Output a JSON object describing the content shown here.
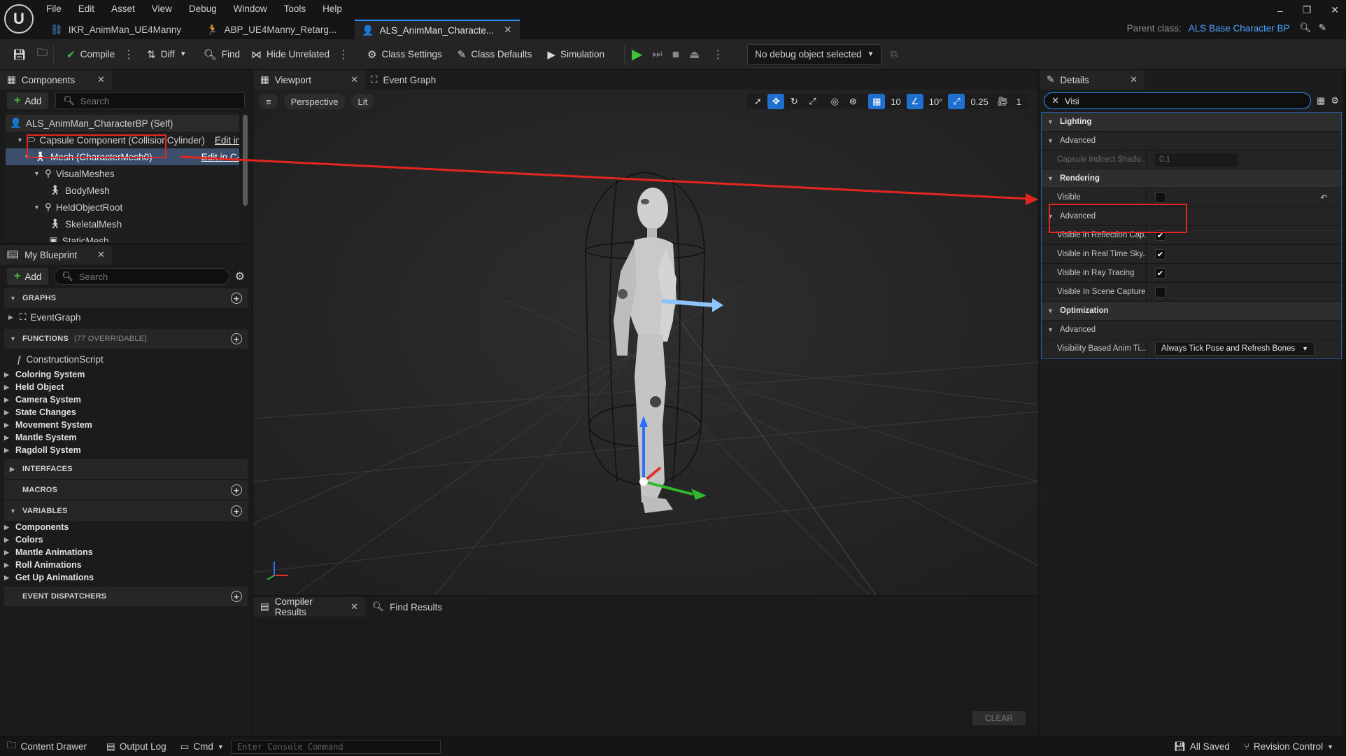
{
  "menu": [
    "File",
    "Edit",
    "Asset",
    "View",
    "Debug",
    "Window",
    "Tools",
    "Help"
  ],
  "tabs": [
    {
      "label": "IKR_AnimMan_UE4Manny",
      "icon": "ik-rig-icon"
    },
    {
      "label": "ABP_UE4Manny_Retarg...",
      "icon": "anim-blueprint-icon"
    },
    {
      "label": "ALS_AnimMan_Characte...",
      "icon": "blueprint-character-icon"
    }
  ],
  "parent_class": {
    "label": "Parent class:",
    "value": "ALS Base Character BP"
  },
  "toolbar": {
    "compile": "Compile",
    "diff": "Diff",
    "find": "Find",
    "hide_unrelated": "Hide Unrelated",
    "class_settings": "Class Settings",
    "class_defaults": "Class Defaults",
    "simulation": "Simulation",
    "debug_object": "No debug object selected"
  },
  "components": {
    "tab": "Components",
    "add": "Add",
    "search_placeholder": "Search",
    "tree": [
      {
        "label": "ALS_AnimMan_CharacterBP (Self)",
        "indent": 0
      },
      {
        "label": "Capsule Component (CollisionCylinder)",
        "indent": 1,
        "edit": "Edit in C"
      },
      {
        "label": "Mesh (CharacterMesh0)",
        "indent": 2,
        "edit": "Edit in C++"
      },
      {
        "label": "VisualMeshes",
        "indent": 3
      },
      {
        "label": "BodyMesh",
        "indent": 4
      },
      {
        "label": "HeldObjectRoot",
        "indent": 3
      },
      {
        "label": "SkeletalMesh",
        "indent": 4
      },
      {
        "label": "StaticMesh",
        "indent": 4
      }
    ]
  },
  "my_blueprint": {
    "tab": "My Blueprint",
    "add": "Add",
    "search_placeholder": "Search",
    "graphs_header": "GRAPHS",
    "event_graph": "EventGraph",
    "functions_header": "FUNCTIONS",
    "functions_count": "(77 OVERRIDABLE)",
    "construction_script": "ConstructionScript",
    "function_categories": [
      "Coloring System",
      "Held Object",
      "Camera System",
      "State Changes",
      "Movement System",
      "Mantle System",
      "Ragdoll System"
    ],
    "interfaces_header": "INTERFACES",
    "macros_header": "MACROS",
    "variables_header": "VARIABLES",
    "variable_categories": [
      "Components",
      "Colors",
      "Mantle Animations",
      "Roll Animations",
      "Get Up Animations"
    ],
    "event_dispatchers_header": "EVENT DISPATCHERS"
  },
  "viewport": {
    "tab": "Viewport",
    "event_graph_tab": "Event Graph",
    "perspective": "Perspective",
    "lit": "Lit",
    "grid_snap": "10",
    "rotation_snap": "10°",
    "scale_snap": "0.25",
    "camera_speed": "1"
  },
  "bottom_panel": {
    "compiler_results": "Compiler Results",
    "find_results": "Find Results",
    "clear": "CLEAR"
  },
  "details": {
    "tab": "Details",
    "search_value": "Visi",
    "lighting": "Lighting",
    "advanced": "Advanced",
    "capsule_shadow_label": "Capsule Indirect Shado...",
    "capsule_shadow_value": "0.1",
    "rendering": "Rendering",
    "visible": "Visible",
    "visible_reflection": "Visible in Reflection Cap...",
    "visible_realtime_sky": "Visible in Real Time Sky...",
    "visible_ray_tracing": "Visible in Ray Tracing",
    "visible_scene_capture": "Visible In Scene Capture...",
    "optimization": "Optimization",
    "vis_based_anim_label": "Visibility Based Anim Ti...",
    "vis_based_anim_value": "Always Tick Pose and Refresh Bones",
    "checks": {
      "visible": false,
      "reflection": true,
      "realtime_sky": true,
      "ray_tracing": true,
      "scene_capture": false
    }
  },
  "status": {
    "content_drawer": "Content Drawer",
    "output_log": "Output Log",
    "cmd": "Cmd",
    "console_placeholder": "Enter Console Command",
    "all_saved": "All Saved",
    "revision_control": "Revision Control"
  },
  "colors": {
    "accent": "#2a8cff",
    "annotation_red": "#e3261f",
    "play_green": "#3dc23d"
  }
}
